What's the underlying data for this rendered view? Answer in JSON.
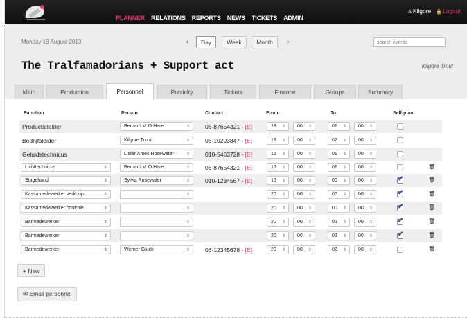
{
  "nav": {
    "items": [
      "PLANNER",
      "RELATIONS",
      "REPORTS",
      "NEWS",
      "TICKETS",
      "ADMIN"
    ],
    "active": "PLANNER",
    "user": "Kilgore",
    "logout": "Logout"
  },
  "header": {
    "date": "Monday 19 August 2013",
    "prev": "‹",
    "next": "›",
    "views": [
      "Day",
      "Week",
      "Month"
    ],
    "active_view": "Day",
    "search_placeholder": "search events",
    "event_title": "The Tralfamadorians + Support act",
    "manager": "Kilgore Trout"
  },
  "tabs": [
    "Main",
    "Production",
    "Personnel",
    "Publicity",
    "Tickets",
    "Finance",
    "Groups",
    "Summary"
  ],
  "active_tab": "Personnel",
  "columns": {
    "function": "Function",
    "person": "Person",
    "contact": "Contact",
    "from": "From",
    "to": "To",
    "selfplan": "Self-plan"
  },
  "rows": [
    {
      "function": "Productieleider",
      "function_select": false,
      "person": "Bernard V. O Hare",
      "contact": "06-87654321",
      "contact_tag": "[E]",
      "from_h": "18",
      "from_m": "00",
      "to_h": "01",
      "to_m": "00",
      "selfplan": false,
      "trash": false
    },
    {
      "function": "Bedrijfsleider",
      "function_select": false,
      "person": "Kilgore Trout",
      "contact": "06-10293847",
      "contact_tag": "[E]",
      "from_h": "19",
      "from_m": "00",
      "to_h": "02",
      "to_m": "00",
      "selfplan": false,
      "trash": false
    },
    {
      "function": "Geluidstechnicus",
      "function_select": false,
      "person": "Lister Ames Rosewater",
      "contact": "010-5463728",
      "contact_tag": "[E]",
      "from_h": "16",
      "from_m": "00",
      "to_h": "01",
      "to_m": "00",
      "selfplan": false,
      "trash": false
    },
    {
      "function": "Lichttechnicus",
      "function_select": true,
      "person": "Bernard V. O Hare",
      "contact": "06-87654321",
      "contact_tag": "[E]",
      "from_h": "16",
      "from_m": "00",
      "to_h": "01",
      "to_m": "00",
      "selfplan": false,
      "trash": true
    },
    {
      "function": "Stagehand",
      "function_select": true,
      "person": "Sylvia Rosewater",
      "contact": "010-1234567",
      "contact_tag": "[E]",
      "from_h": "15",
      "from_m": "00",
      "to_h": "00",
      "to_m": "00",
      "selfplan": true,
      "trash": true
    },
    {
      "function": "Kassamedewerker verkoop",
      "function_select": true,
      "person": "",
      "contact": "",
      "contact_tag": "",
      "from_h": "20",
      "from_m": "00",
      "to_h": "00",
      "to_m": "00",
      "selfplan": true,
      "trash": true
    },
    {
      "function": "Kassamedewerker controle",
      "function_select": true,
      "person": "",
      "contact": "",
      "contact_tag": "",
      "from_h": "20",
      "from_m": "00",
      "to_h": "00",
      "to_m": "00",
      "selfplan": true,
      "trash": true
    },
    {
      "function": "Barmedewerker",
      "function_select": true,
      "person": "",
      "contact": "",
      "contact_tag": "",
      "from_h": "20",
      "from_m": "00",
      "to_h": "02",
      "to_m": "00",
      "selfplan": true,
      "trash": true
    },
    {
      "function": "Barmedewerker",
      "function_select": true,
      "person": "",
      "contact": "",
      "contact_tag": "",
      "from_h": "20",
      "from_m": "00",
      "to_h": "02",
      "to_m": "00",
      "selfplan": true,
      "trash": true
    },
    {
      "function": "Barmedewerker",
      "function_select": true,
      "person": "Werner Gluck",
      "contact": "06-12345678",
      "contact_tag": "[E]",
      "from_h": "20",
      "from_m": "00",
      "to_h": "02",
      "to_m": "00",
      "selfplan": false,
      "trash": true
    }
  ],
  "buttons": {
    "new": "+ New",
    "email": "✉ Email personnel"
  },
  "colors": {
    "accent": "#e6337a",
    "topbar": "#111111",
    "header_bg": "#ededed"
  }
}
